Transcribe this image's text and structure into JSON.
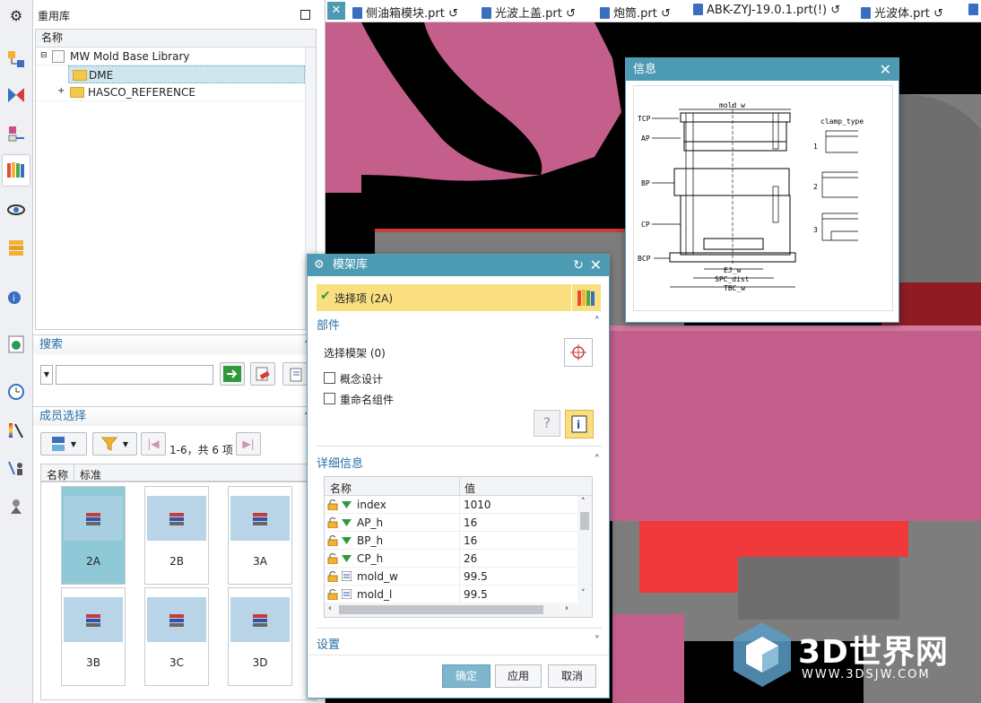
{
  "tabs": [
    {
      "label": "侧油箱模块.prt"
    },
    {
      "label": "光波上盖.prt"
    },
    {
      "label": "炮筒.prt"
    },
    {
      "label": "ABK-ZYJ-19.0.1.prt(!)"
    },
    {
      "label": "光波体.prt"
    }
  ],
  "reuse": {
    "title": "重用库",
    "tree_header": "名称",
    "tree": [
      {
        "label": "MW Mold Base Library"
      },
      {
        "label": "DME"
      },
      {
        "label": "HASCO_REFERENCE"
      }
    ],
    "search_label": "搜索",
    "search_value": "",
    "member_label": "成员选择",
    "pager": "1-6，共 6 项",
    "col_tabs": [
      "名称",
      "标准"
    ],
    "members": [
      "2A",
      "2B",
      "3A",
      "3B",
      "3C",
      "3D"
    ]
  },
  "moldbase": {
    "title": "模架库",
    "select_item": "选择项 (2A)",
    "part_group": "部件",
    "select_base": "选择模架 (0)",
    "concept": "概念设计",
    "rename": "重命名组件",
    "detail_group": "详细信息",
    "col_name": "名称",
    "col_value": "值",
    "rows": [
      {
        "name": "index",
        "value": "1010",
        "type": "arrow"
      },
      {
        "name": "AP_h",
        "value": "16",
        "type": "arrow"
      },
      {
        "name": "BP_h",
        "value": "16",
        "type": "arrow"
      },
      {
        "name": "CP_h",
        "value": "26",
        "type": "arrow"
      },
      {
        "name": "mold_w",
        "value": "99.5",
        "type": "expr"
      },
      {
        "name": "mold_l",
        "value": "99.5",
        "type": "expr"
      }
    ],
    "settings_group": "设置",
    "ok": "确定",
    "apply": "应用",
    "cancel": "取消"
  },
  "info": {
    "title": "信息",
    "labels": [
      "TCP",
      "AP",
      "BP",
      "CP",
      "BCP",
      "mold_w",
      "clamp_type",
      "EJ_w",
      "SPC_dist",
      "TBC_w",
      "1",
      "2",
      "3"
    ]
  },
  "watermark": {
    "brand": "3D世界网",
    "url": "WWW.3DSJW.COM"
  },
  "colors": {
    "accent": "#4d9ab3",
    "pink": "#c45f8c",
    "red": "#f0393b",
    "gray": "#7d7d7d"
  }
}
